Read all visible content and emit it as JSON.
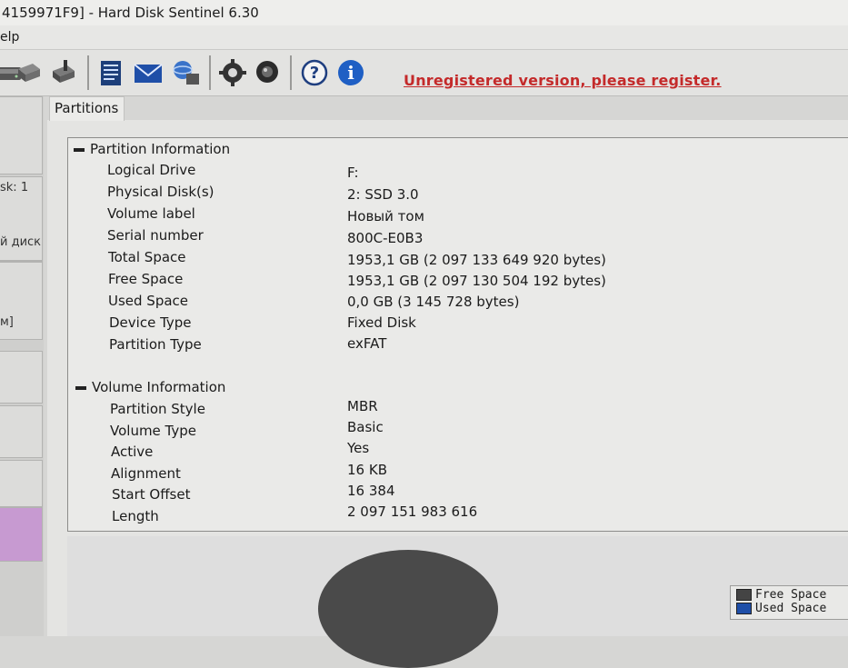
{
  "window": {
    "title": "4159971F9]  -  Hard Disk Sentinel 6.30"
  },
  "menu": {
    "items": [
      "elp"
    ]
  },
  "toolbar": {
    "register_text": "Unregistered version, please register.",
    "icons": [
      "hard-disk-icon",
      "disk-drive-icon",
      "drive-tool-icon",
      "report-icon",
      "mail-icon",
      "network-drive-icon",
      "settings-gear-icon",
      "webcam-icon",
      "help-icon",
      "info-icon"
    ],
    "help_glyph": "?",
    "info_glyph": "i",
    "accent_color": "#c42a2a"
  },
  "left_panel": {
    "tiles": [
      {
        "text": ""
      },
      {
        "text": "sk: 1"
      },
      {
        "text": "й диск"
      },
      {
        "text": "м]"
      },
      {
        "text": ""
      },
      {
        "text": ""
      },
      {
        "text": ""
      },
      {
        "text": ""
      }
    ]
  },
  "tabs": [
    {
      "label": "Partitions"
    }
  ],
  "partition_info": {
    "title": "Partition Information",
    "rows": [
      {
        "label": "Logical Drive",
        "value": "F:"
      },
      {
        "label": "Physical Disk(s)",
        "value": "2: SSD 3.0"
      },
      {
        "label": "Volume label",
        "value": "Новый том"
      },
      {
        "label": "Serial number",
        "value": "800C-E0B3"
      },
      {
        "label": "Total Space",
        "value": "1953,1 GB (2 097 133 649 920 bytes)"
      },
      {
        "label": "Free Space",
        "value": "1953,1 GB (2 097 130 504 192 bytes)"
      },
      {
        "label": "Used Space",
        "value": "0,0 GB (3 145 728 bytes)"
      },
      {
        "label": "Device Type",
        "value": "Fixed Disk"
      },
      {
        "label": "Partition Type",
        "value": "exFAT"
      }
    ]
  },
  "volume_info": {
    "title": "Volume Information",
    "rows": [
      {
        "label": "Partition Style",
        "value": "MBR"
      },
      {
        "label": "Volume Type",
        "value": "Basic"
      },
      {
        "label": "Active",
        "value": "Yes"
      },
      {
        "label": "Alignment",
        "value": "16 KB"
      },
      {
        "label": "Start Offset",
        "value": "16 384"
      },
      {
        "label": "Length",
        "value": "2 097 151 983 616"
      }
    ]
  },
  "legend": {
    "free_label": "Free Space",
    "used_label": "Used Space",
    "free_color": "#444444",
    "used_color": "#1f4fa8"
  }
}
